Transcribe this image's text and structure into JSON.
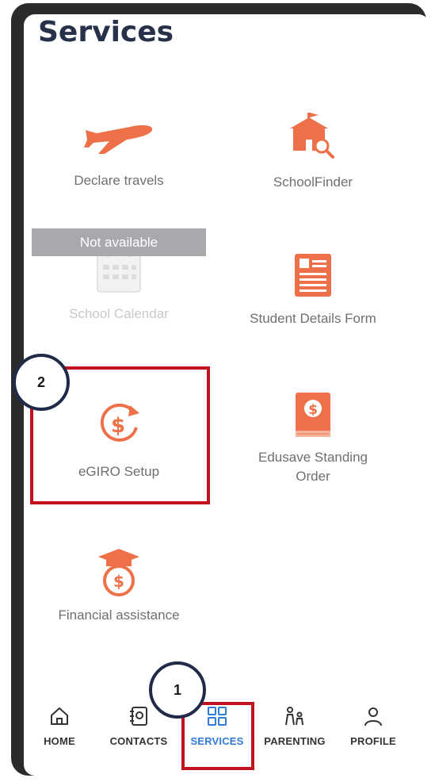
{
  "page": {
    "title": "Services"
  },
  "services": {
    "declare_travels": "Declare travels",
    "school_finder": "SchoolFinder",
    "school_calendar": "School Calendar",
    "school_calendar_status": "Not available",
    "student_details_form": "Student Details Form",
    "egiro_setup": "eGIRO Setup",
    "edusave_line1": "Edusave Standing",
    "edusave_line2": "Order",
    "financial_assistance": "Financial assistance"
  },
  "annotations": {
    "step1": "1",
    "step2": "2",
    "highlight_color": "#c2121d"
  },
  "nav": {
    "home": "HOME",
    "contacts": "CONTACTS",
    "services": "SERVICES",
    "parenting": "PARENTING",
    "profile": "PROFILE",
    "active": "services",
    "active_color": "#2f7bd8"
  },
  "colors": {
    "accent": "#ee7048",
    "title": "#27324a"
  }
}
